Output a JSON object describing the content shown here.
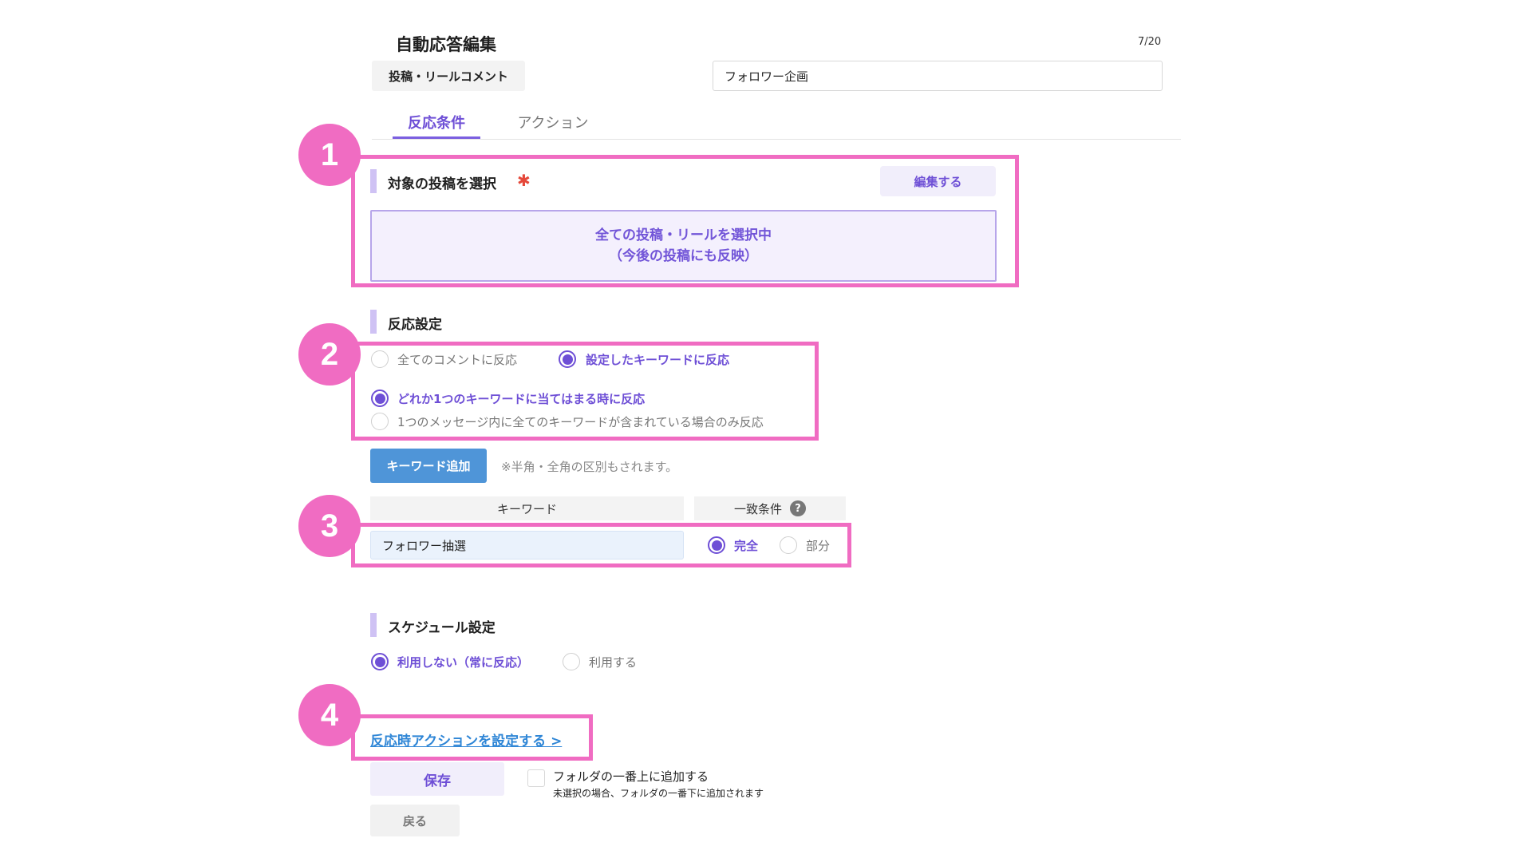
{
  "header": {
    "title": "自動応答編集",
    "char_count": "7/20",
    "type_chip": "投稿・リールコメント",
    "name_value": "フォロワー企画"
  },
  "tabs": [
    {
      "label": "反応条件",
      "active": true
    },
    {
      "label": "アクション",
      "active": false
    }
  ],
  "badges": [
    "1",
    "2",
    "3",
    "4"
  ],
  "target_posts": {
    "title": "対象の投稿を選択",
    "required_mark": "✱",
    "edit_label": "編集する",
    "selected_line1": "全ての投稿・リールを選択中",
    "selected_line2": "（今後の投稿にも反映）"
  },
  "reaction": {
    "title": "反応設定",
    "options": [
      {
        "label": "全てのコメントに反応",
        "selected": false
      },
      {
        "label": "設定したキーワードに反応",
        "selected": true
      }
    ],
    "match_options": [
      {
        "label": "どれか1つのキーワードに当てはまる時に反応",
        "selected": true
      },
      {
        "label": "1つのメッセージ内に全てのキーワードが含まれている場合のみ反応",
        "selected": false
      }
    ]
  },
  "keywords": {
    "add_label": "キーワード追加",
    "note": "※半角・全角の区別もされます。",
    "col_keyword": "キーワード",
    "col_match": "一致条件",
    "help_glyph": "?",
    "row_value": "フォロワー抽選",
    "match_exact": "完全",
    "match_partial": "部分"
  },
  "schedule": {
    "title": "スケジュール設定",
    "off_label": "利用しない（常に反応）",
    "on_label": "利用する"
  },
  "footer": {
    "action_link": "反応時アクションを設定する >",
    "save_label": "保存",
    "checkbox_label": "フォルダの一番上に追加する",
    "checkbox_sub": "未選択の場合、フォルダの一番下に追加されます",
    "back_label": "戻る"
  },
  "colors": {
    "accent": "#6e4fd6",
    "highlight": "#f06cc2",
    "button_blue": "#4f95d8",
    "link": "#2f86d6",
    "required": "#e5483a"
  }
}
